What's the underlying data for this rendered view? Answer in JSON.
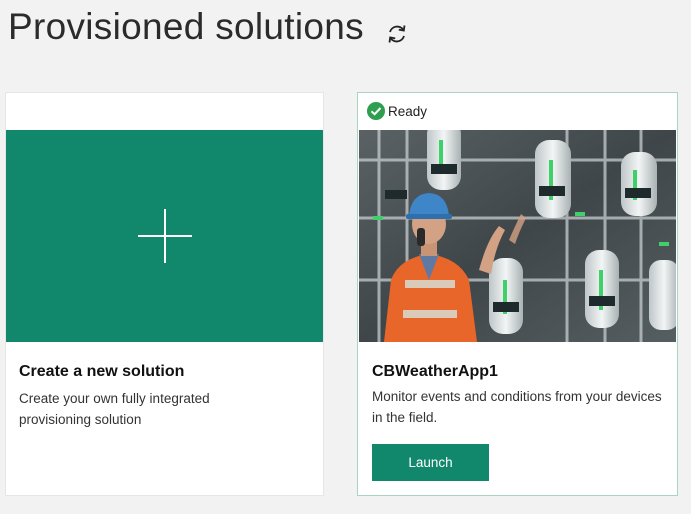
{
  "page": {
    "title": "Provisioned solutions",
    "refresh_icon": "refresh-icon"
  },
  "create_card": {
    "title": "Create a new solution",
    "description": "Create your own fully integrated provisioning solution",
    "tile_color": "#11876b",
    "icon": "plus-icon"
  },
  "solution_card": {
    "status": "Ready",
    "status_icon": "check-circle-icon",
    "status_color": "#2e9e4f",
    "name": "CBWeatherApp1",
    "description": "Monitor events and conditions from your devices in the field.",
    "image": "industrial-worker-photo",
    "launch_label": "Launch",
    "accent_color": "#11876b"
  }
}
